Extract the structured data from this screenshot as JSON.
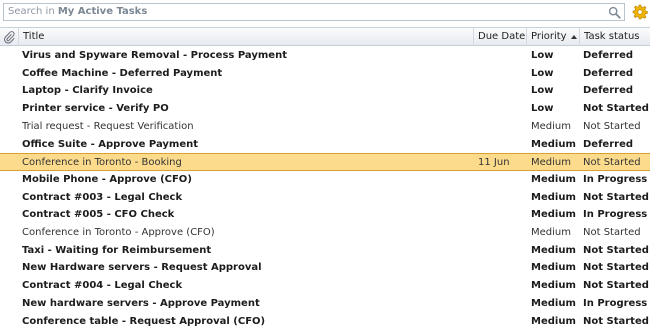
{
  "search": {
    "prefix": "Search in ",
    "scope": "My Active Tasks"
  },
  "columns": {
    "title": "Title",
    "due_date": "Due Date",
    "priority": "Priority",
    "status": "Task status"
  },
  "icons": {
    "search": "search-icon",
    "settings": "gear-icon",
    "attachment": "paperclip-icon",
    "sort": "sort-ascending-icon"
  },
  "colors": {
    "selected_row": "#fcdc8c",
    "selected_border": "#d7a22f",
    "header_bg": "#e9edf1"
  },
  "tasks": [
    {
      "title": "Virus and Spyware Removal - Process Payment",
      "due": "",
      "priority": "Low",
      "status": "Deferred",
      "bold": true
    },
    {
      "title": "Coffee Machine - Deferred Payment",
      "due": "",
      "priority": "Low",
      "status": "Deferred",
      "bold": true
    },
    {
      "title": "Laptop - Clarify Invoice",
      "due": "",
      "priority": "Low",
      "status": "Deferred",
      "bold": true
    },
    {
      "title": "Printer service - Verify PO",
      "due": "",
      "priority": "Low",
      "status": "Not Started",
      "bold": true
    },
    {
      "title": "Trial request - Request Verification",
      "due": "",
      "priority": "Medium",
      "status": "Not Started",
      "bold": false
    },
    {
      "title": "Office Suite - Approve Payment",
      "due": "",
      "priority": "Medium",
      "status": "Deferred",
      "bold": true
    },
    {
      "title": "Conference in Toronto - Booking",
      "due": "11 Jun",
      "priority": "Medium",
      "status": "Not Started",
      "bold": false,
      "selected": true
    },
    {
      "title": "Mobile Phone - Approve (CFO)",
      "due": "",
      "priority": "Medium",
      "status": "In Progress",
      "bold": true
    },
    {
      "title": "Contract #003 - Legal Check",
      "due": "",
      "priority": "Medium",
      "status": "Not Started",
      "bold": true
    },
    {
      "title": "Contract #005 - CFO Check",
      "due": "",
      "priority": "Medium",
      "status": "In Progress",
      "bold": true
    },
    {
      "title": "Conference in Toronto - Approve (CFO)",
      "due": "",
      "priority": "Medium",
      "status": "Not Started",
      "bold": false
    },
    {
      "title": "Taxi - Waiting for Reimbursement",
      "due": "",
      "priority": "Medium",
      "status": "Not Started",
      "bold": true
    },
    {
      "title": "New Hardware servers - Request Approval",
      "due": "",
      "priority": "Medium",
      "status": "Not Started",
      "bold": true
    },
    {
      "title": "Contract #004 - Legal Check",
      "due": "",
      "priority": "Medium",
      "status": "Not Started",
      "bold": true
    },
    {
      "title": "New hardware servers - Approve Payment",
      "due": "",
      "priority": "Medium",
      "status": "In Progress",
      "bold": true
    },
    {
      "title": "Conference table - Request Approval (CFO)",
      "due": "",
      "priority": "Medium",
      "status": "Not Started",
      "bold": true
    }
  ]
}
